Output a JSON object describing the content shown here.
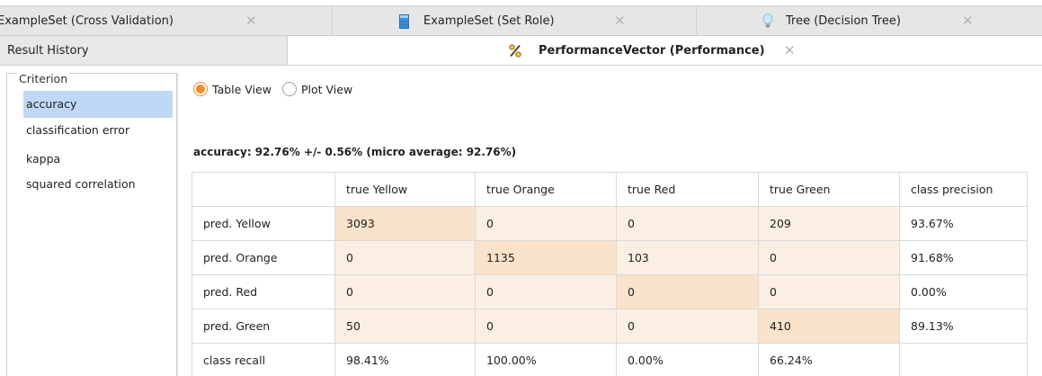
{
  "top_tabs": [
    {
      "label": "ExampleSet (Cross Validation)",
      "icon": "none"
    },
    {
      "label": "ExampleSet (Set Role)",
      "icon": "table-icon"
    },
    {
      "label": "Tree (Decision Tree)",
      "icon": "lightbulb-icon"
    }
  ],
  "close_glyph": "✕",
  "result_history_label": "Result History",
  "active_tab": {
    "label": "PerformanceVector (Performance)",
    "icon": "percent-icon"
  },
  "criterion": {
    "legend": "Criterion",
    "items": [
      "accuracy",
      "classification error",
      "kappa",
      "squared correlation"
    ],
    "selected": "accuracy"
  },
  "view_toggle": {
    "options": [
      "Table View",
      "Plot View"
    ],
    "selected": "Table View"
  },
  "summary": "accuracy: 92.76% +/- 0.56% (micro average: 92.76%)",
  "matrix": {
    "headers": [
      "",
      "true Yellow",
      "true Orange",
      "true Red",
      "true Green",
      "class precision"
    ],
    "rows": [
      [
        "pred. Yellow",
        "3093",
        "0",
        "0",
        "209",
        "93.67%"
      ],
      [
        "pred. Orange",
        "0",
        "1135",
        "103",
        "0",
        "91.68%"
      ],
      [
        "pred. Red",
        "0",
        "0",
        "0",
        "0",
        "0.00%"
      ],
      [
        "pred. Green",
        "50",
        "0",
        "0",
        "410",
        "89.13%"
      ]
    ],
    "recall_row": [
      "class recall",
      "98.41%",
      "100.00%",
      "0.00%",
      "66.24%",
      ""
    ]
  },
  "colors": {
    "selection": "#bed8f5",
    "radio_accent": "#f08c28",
    "cell_diagonal": "#fae3cb",
    "cell_offdiag": "#fbefe3"
  }
}
